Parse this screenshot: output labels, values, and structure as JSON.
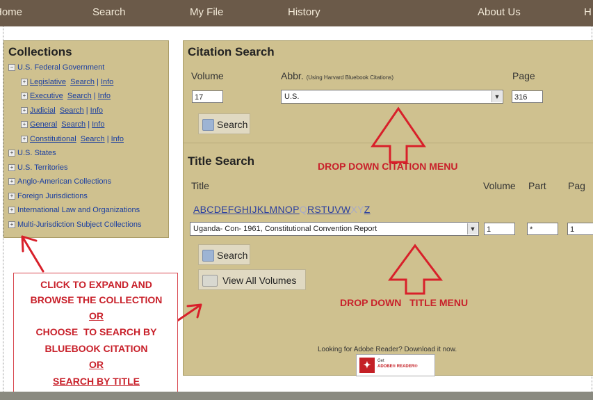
{
  "nav": [
    "Home",
    "Search",
    "My File",
    "History",
    "About Us",
    "H"
  ],
  "collections": {
    "title": "Collections",
    "federal": "U.S. Federal Government",
    "sub_items": [
      {
        "label": "Legislative",
        "search": "Search",
        "sep": "|",
        "info": "Info"
      },
      {
        "label": "Executive",
        "search": "Search",
        "sep": "|",
        "info": "Info"
      },
      {
        "label": "Judicial",
        "search": "Search",
        "sep": "|",
        "info": "Info"
      },
      {
        "label": "General",
        "search": "Search",
        "sep": "|",
        "info": "Info"
      },
      {
        "label": "Constitutional",
        "search": "Search",
        "sep": "|",
        "info": "Info"
      }
    ],
    "top_items": [
      "U.S. States",
      "U.S. Territories",
      "Anglo-American Collections",
      "Foreign Jurisdictions",
      "International Law and Organizations",
      "Multi-Jurisdiction Subject Collections"
    ]
  },
  "citation": {
    "title": "Citation Search",
    "volume_label": "Volume",
    "abbr_label": "Abbr.",
    "abbr_note": "(Using Harvard Bluebook Citations)",
    "page_label": "Page",
    "volume_value": "17",
    "abbr_value": "U.S.",
    "page_value": "316",
    "search_button": "Search"
  },
  "title_search": {
    "title": "Title Search",
    "title_label": "Title",
    "volume_label": "Volume",
    "part_label": "Part",
    "page_label": "Pag",
    "letters": [
      "A",
      "B",
      "C",
      "D",
      "E",
      "F",
      "G",
      "H",
      "I",
      "J",
      "K",
      "L",
      "M",
      "N",
      "O",
      "P",
      "Q",
      "R",
      "S",
      "T",
      "U",
      "V",
      "W",
      "X",
      "Y",
      "Z"
    ],
    "dim_letters": [
      "Q",
      "X",
      "Y"
    ],
    "title_value": "Uganda- Con- 1961, Constitutional Convention Report",
    "volume_value": "1",
    "part_value": "*",
    "page_value": "1",
    "search_button": "Search",
    "view_all_button": "View All Volumes"
  },
  "adobe": {
    "text": "Looking for Adobe Reader? Download it now.",
    "button_get": "Get",
    "button_name": "ADOBE® READER®"
  },
  "annotations": {
    "citation_menu": "DROP DOWN CITATION MENU",
    "title_menu": "DROP DOWN   TITLE MENU",
    "box_lines": [
      "CLICK TO EXPAND AND",
      "BROWSE THE COLLECTION",
      "OR",
      "CHOOSE  TO SEARCH BY",
      "BLUEBOOK CITATION",
      "OR",
      "SEARCH BY TITLE"
    ]
  },
  "colors": {
    "annotation_red": "#c8202a",
    "panel": "#cfc18f",
    "nav_bar": "#6b5a49"
  }
}
